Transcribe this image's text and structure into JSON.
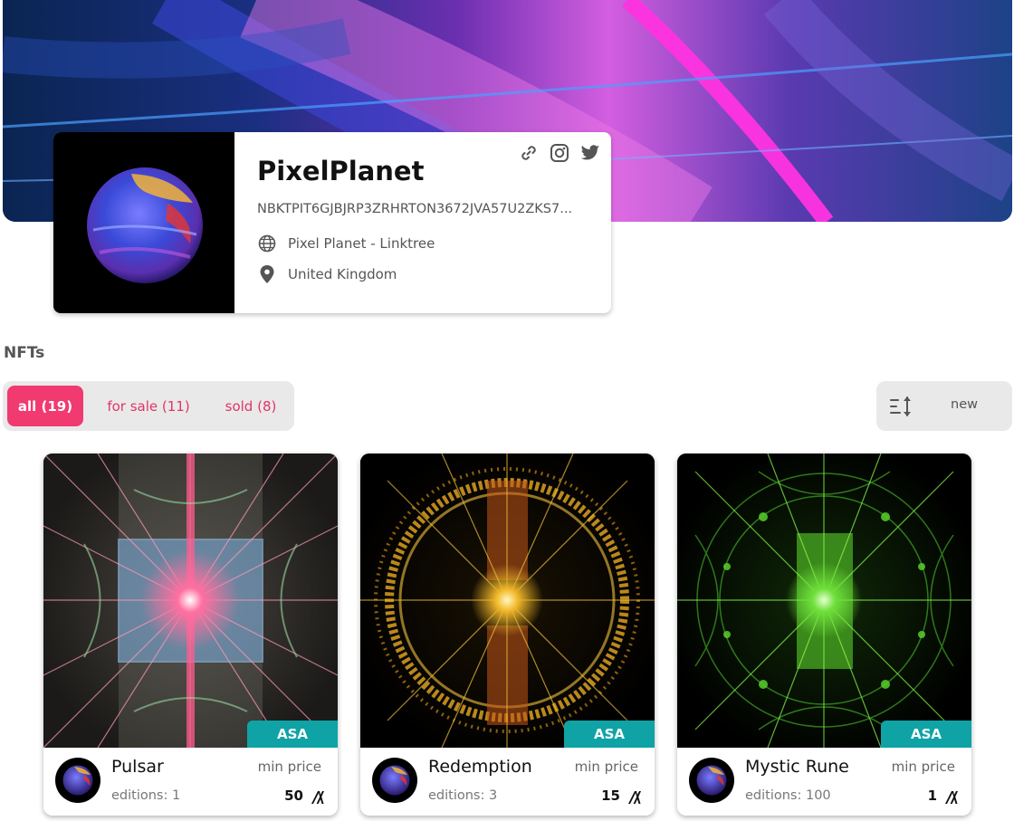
{
  "profile": {
    "name": "PixelPlanet",
    "address": "NBKTPIT6GJBJRP3ZRHRTON3672JVA57U2ZKS7...",
    "website": "Pixel Planet - Linktree",
    "location": "United Kingdom",
    "icons": {
      "link": "link-icon",
      "instagram": "instagram-icon",
      "twitter": "twitter-icon",
      "website": "globe-icon",
      "location": "location-pin-icon"
    }
  },
  "nfts_section": {
    "title": "NFTs",
    "filters": [
      {
        "label": "all (19)",
        "active": true
      },
      {
        "label": "for sale (11)",
        "active": false
      },
      {
        "label": "sold (8)",
        "active": false
      }
    ],
    "sort": {
      "label": "new",
      "icon": "sort-icon"
    }
  },
  "cards": [
    {
      "title": "Pulsar",
      "badge": "ASA",
      "editions": "editions: 1",
      "price_label": "min price",
      "price": "50",
      "art_color": "#ff6fa0"
    },
    {
      "title": "Redemption",
      "badge": "ASA",
      "editions": "editions: 3",
      "price_label": "min price",
      "price": "15",
      "art_color": "#f2b82a"
    },
    {
      "title": "Mystic Rune",
      "badge": "ASA",
      "editions": "editions: 100",
      "price_label": "min price",
      "price": "1",
      "art_color": "#6fe03a"
    }
  ],
  "colors": {
    "accent": "#f03a70",
    "badge": "#0fa3a6",
    "filter_bg": "#e9e9e9"
  }
}
